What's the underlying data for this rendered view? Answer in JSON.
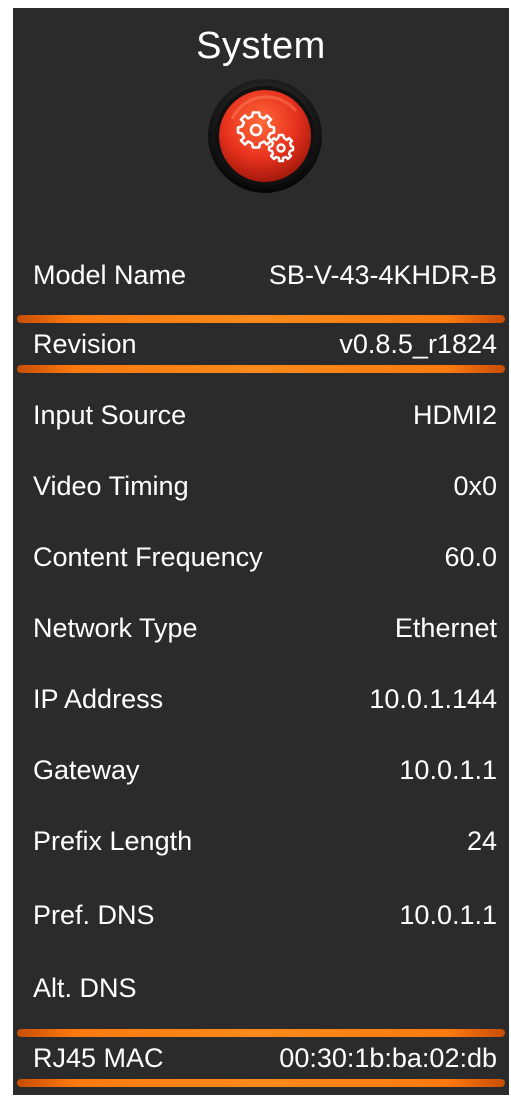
{
  "header": {
    "title": "System",
    "icon": "gears-icon"
  },
  "colors": {
    "panel_background": "#2b2b2b",
    "text": "#ffffff",
    "accent": "#ff7a10",
    "icon_red": "#e8321e"
  },
  "rows": [
    {
      "label": "Model Name",
      "value": "SB-V-43-4KHDR-B"
    },
    {
      "label": "Revision",
      "value": "v0.8.5_r1824"
    },
    {
      "label": "Input Source",
      "value": "HDMI2"
    },
    {
      "label": "Video Timing",
      "value": "0x0"
    },
    {
      "label": "Content Frequency",
      "value": "60.0"
    },
    {
      "label": "Network Type",
      "value": "Ethernet"
    },
    {
      "label": "IP Address",
      "value": "10.0.1.144"
    },
    {
      "label": "Gateway",
      "value": "10.0.1.1"
    },
    {
      "label": "Prefix Length",
      "value": "24"
    },
    {
      "label": "Pref. DNS",
      "value": "10.0.1.1"
    },
    {
      "label": "Alt. DNS",
      "value": ""
    },
    {
      "label": "RJ45 MAC",
      "value": "00:30:1b:ba:02:db"
    }
  ]
}
